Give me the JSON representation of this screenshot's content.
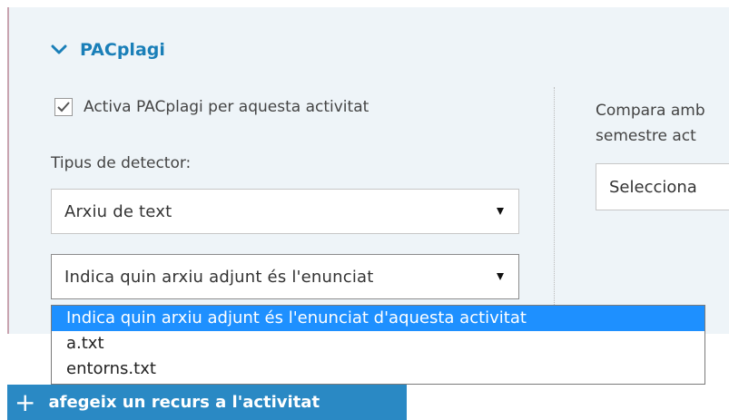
{
  "section": {
    "title": "PACplagi",
    "expanded": true
  },
  "activate": {
    "label": "Activa PACplagi per aquesta activitat",
    "checked": true
  },
  "detector": {
    "label": "Tipus de detector:",
    "type_value": "Arxiu de text",
    "file_value": "Indica quin arxiu adjunt és l'enunciat",
    "options": [
      "Indica quin arxiu adjunt és l'enunciat d'aquesta activitat",
      "a.txt",
      "entorns.txt"
    ],
    "selected_index": 0
  },
  "compare": {
    "line1": "Compara amb",
    "line2": "semestre act",
    "select_value": "Selecciona"
  },
  "add_resource": {
    "label": "afegeix un recurs a l'activitat"
  },
  "colors": {
    "accent": "#1a7fb8",
    "button": "#2a89c4",
    "highlight": "#1e90ff",
    "panel": "#eef4f8"
  }
}
